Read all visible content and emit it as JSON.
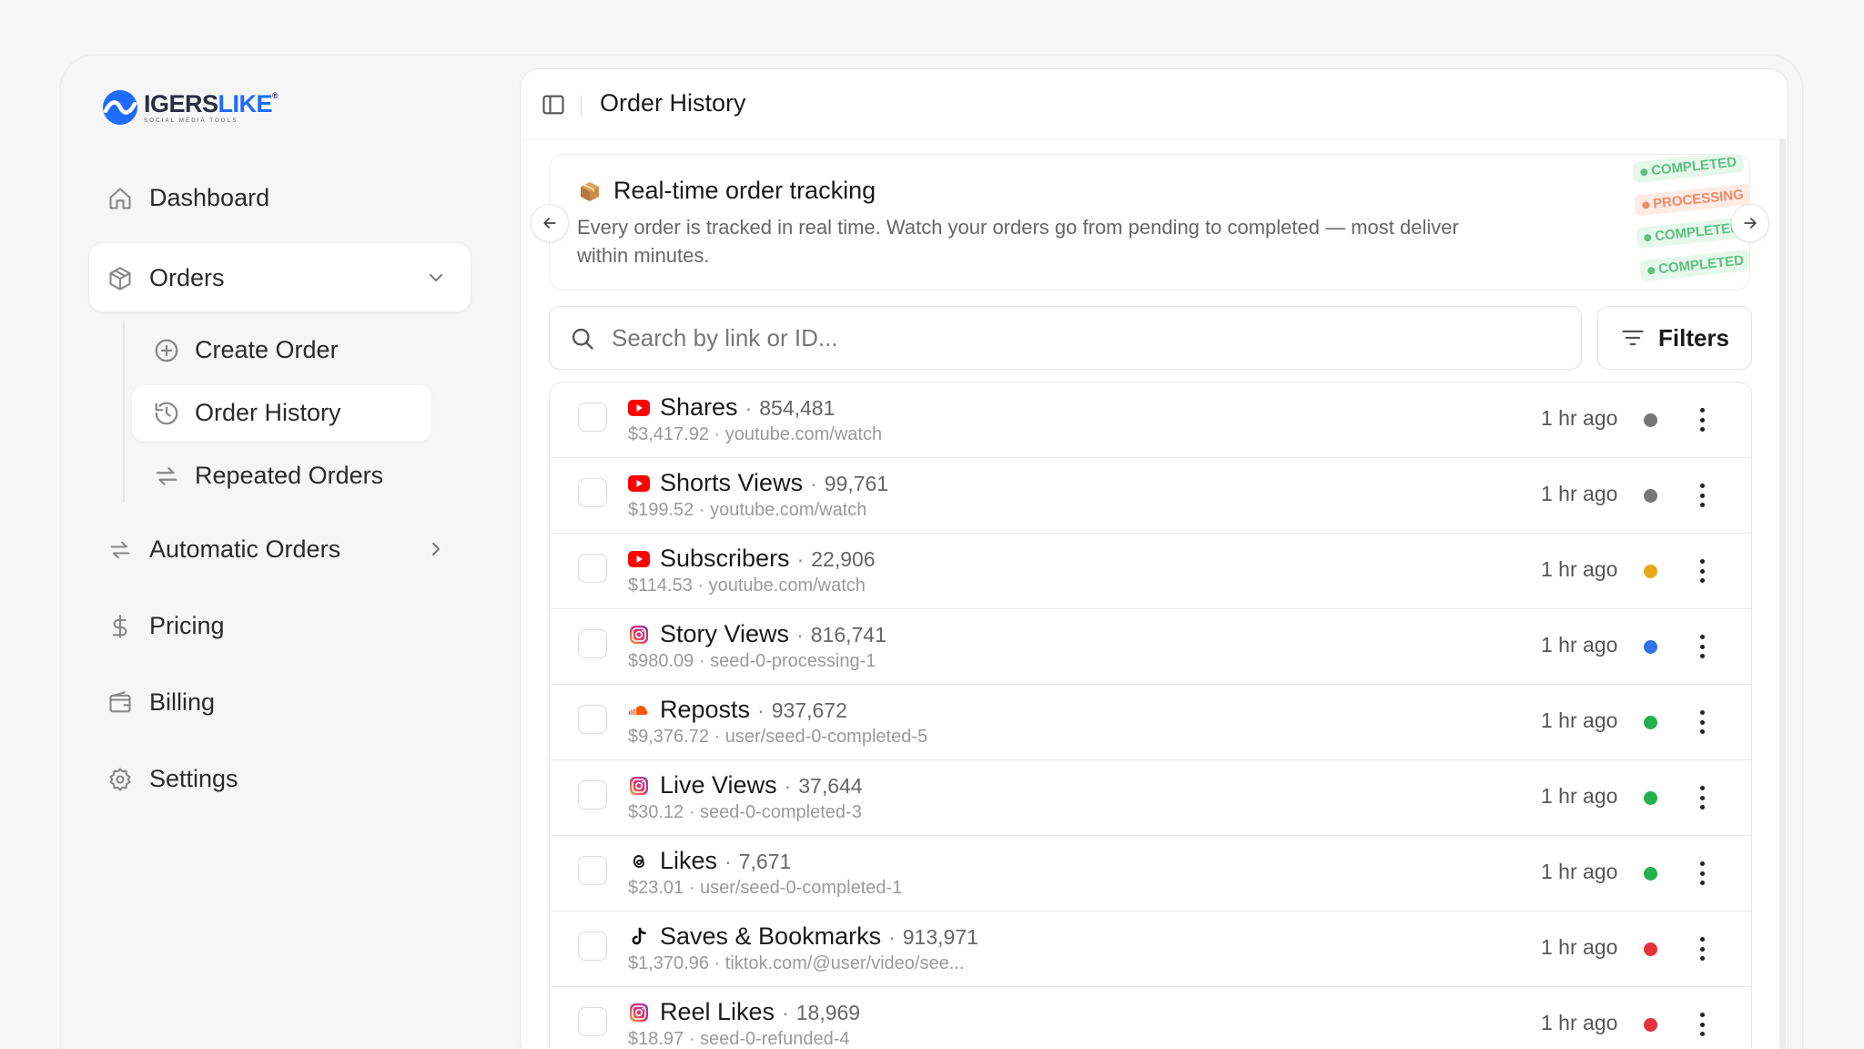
{
  "brand": {
    "name_part1": "IGERS",
    "name_part2": "LIKE",
    "tagline": "SOCIAL MEDIA TOOLS",
    "trademark": "®"
  },
  "sidebar": {
    "items": [
      {
        "label": "Dashboard",
        "icon": "home-icon"
      },
      {
        "label": "Orders",
        "icon": "package-icon",
        "expanded": true
      },
      {
        "label": "Automatic Orders",
        "icon": "repeat-icon"
      },
      {
        "label": "Pricing",
        "icon": "dollar-icon"
      },
      {
        "label": "Billing",
        "icon": "wallet-icon"
      },
      {
        "label": "Settings",
        "icon": "gear-icon"
      }
    ],
    "orders_sub": [
      {
        "label": "Create Order",
        "icon": "plus-circle-icon"
      },
      {
        "label": "Order History",
        "icon": "history-icon",
        "active": true
      },
      {
        "label": "Repeated Orders",
        "icon": "repeat-icon"
      }
    ]
  },
  "header": {
    "title": "Order History"
  },
  "banner": {
    "title": "Real-time order tracking",
    "description": "Every order is tracked in real time. Watch your orders go from pending to completed — most deliver within minutes.",
    "stickers": [
      "COMPLETED",
      "PROCESSING",
      "COMPLETED",
      "COMPLETED"
    ]
  },
  "search": {
    "placeholder": "Search by link or ID..."
  },
  "filters": {
    "label": "Filters"
  },
  "status_colors": {
    "pending": "#777777",
    "in_progress": "#e9a81b",
    "processing": "#2f74e8",
    "completed": "#22b14c",
    "refunded": "#e5333b"
  },
  "orders": [
    {
      "service": "Shares",
      "qty": "854,481",
      "price": "$3,417.92",
      "link": "youtube.com/watch",
      "platform": "youtube",
      "time": "1 hr ago",
      "status_color": "#777777"
    },
    {
      "service": "Shorts Views",
      "qty": "99,761",
      "price": "$199.52",
      "link": "youtube.com/watch",
      "platform": "youtube",
      "time": "1 hr ago",
      "status_color": "#777777"
    },
    {
      "service": "Subscribers",
      "qty": "22,906",
      "price": "$114.53",
      "link": "youtube.com/watch",
      "platform": "youtube",
      "time": "1 hr ago",
      "status_color": "#e9a81b"
    },
    {
      "service": "Story Views",
      "qty": "816,741",
      "price": "$980.09",
      "link": "seed-0-processing-1",
      "platform": "instagram",
      "time": "1 hr ago",
      "status_color": "#2f74e8"
    },
    {
      "service": "Reposts",
      "qty": "937,672",
      "price": "$9,376.72",
      "link": "user/seed-0-completed-5",
      "platform": "soundcloud",
      "time": "1 hr ago",
      "status_color": "#22b14c"
    },
    {
      "service": "Live Views",
      "qty": "37,644",
      "price": "$30.12",
      "link": "seed-0-completed-3",
      "platform": "instagram",
      "time": "1 hr ago",
      "status_color": "#22b14c"
    },
    {
      "service": "Likes",
      "qty": "7,671",
      "price": "$23.01",
      "link": "user/seed-0-completed-1",
      "platform": "threads",
      "time": "1 hr ago",
      "status_color": "#22b14c"
    },
    {
      "service": "Saves & Bookmarks",
      "qty": "913,971",
      "price": "$1,370.96",
      "link": "tiktok.com/@user/video/see...",
      "platform": "tiktok",
      "time": "1 hr ago",
      "status_color": "#e5333b"
    },
    {
      "service": "Reel Likes",
      "qty": "18,969",
      "price": "$18.97",
      "link": "seed-0-refunded-4",
      "platform": "instagram",
      "time": "1 hr ago",
      "status_color": "#e5333b"
    }
  ]
}
